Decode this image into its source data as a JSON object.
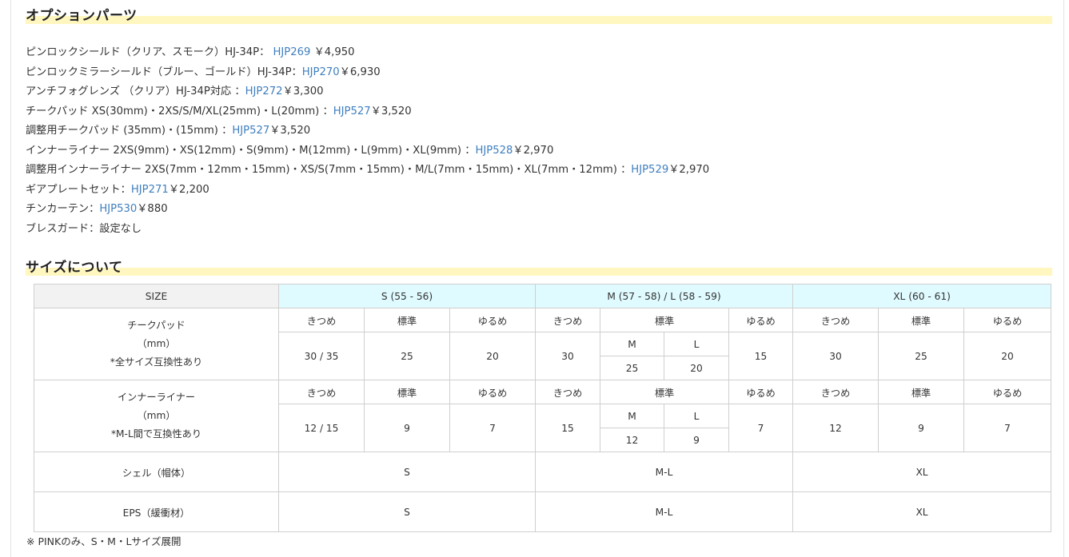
{
  "options_section": {
    "title": "オプションパーツ",
    "items": [
      {
        "text": "ピンロックシールド（クリア、スモーク）HJ-34P：",
        "code": "HJP269",
        "price": "￥4,950"
      },
      {
        "text": "ピンロックミラーシールド（ブルー、ゴールド）HJ-34P：",
        "code": "HJP270",
        "price": "￥6,930"
      },
      {
        "text": "アンチフォグレンズ （クリア）HJ-34P対応 ：",
        "code": "HJP272",
        "price": "￥3,300"
      },
      {
        "text": "チークパッド XS(30mm)・2XS/S/M/XL(25mm)・L(20mm) ：",
        "code": "HJP527",
        "price": "￥3,520"
      },
      {
        "text": "調整用チークパッド (35mm)・(15mm) ：",
        "code": "HJP527",
        "price": "￥3,520"
      },
      {
        "text": "インナーライナー 2XS(9mm)・XS(12mm)・S(9mm)・M(12mm)・L(9mm)・XL(9mm) ：",
        "code": "HJP528",
        "price": "￥2,970"
      },
      {
        "text": "調整用インナーライナー 2XS(7mm・12mm・15mm)・XS/S(7mm・15mm)・M/L(7mm・15mm)・XL(7mm・12mm) ：",
        "code": "HJP529",
        "price": "￥2,970"
      },
      {
        "text": "ギアプレートセット：",
        "code": "HJP271",
        "price": "￥2,200"
      },
      {
        "text": "チンカーテン：",
        "code": "HJP530",
        "price": "￥880"
      },
      {
        "text": "ブレスガード：設定なし",
        "code": "",
        "price": ""
      }
    ]
  },
  "size_section": {
    "title": "サイズについて",
    "header": {
      "label": "SIZE",
      "s": "S (55 - 56)",
      "ml": "M (57 - 58) / L (58 - 59)",
      "xl": "XL (60 - 61)"
    },
    "fit": {
      "tight": "きつめ",
      "standard": "標準",
      "loose": "ゆるめ"
    },
    "ml_split": {
      "m": "M",
      "l": "L"
    },
    "cheek": {
      "label1": "チークパッド",
      "label2": "（mm）",
      "label3": "*全サイズ互換性あり",
      "s_tight": "30 / 35",
      "s_std": "25",
      "s_loose": "20",
      "ml_tight": "30",
      "m_std": "25",
      "l_std": "20",
      "ml_loose": "15",
      "xl_tight": "30",
      "xl_std": "25",
      "xl_loose": "20"
    },
    "inner": {
      "label1": "インナーライナー",
      "label2": "（mm）",
      "label3": "*M-L間で互換性あり",
      "s_tight": "12 / 15",
      "s_std": "9",
      "s_loose": "7",
      "ml_tight": "15",
      "m_std": "12",
      "l_std": "9",
      "ml_loose": "7",
      "xl_tight": "12",
      "xl_std": "9",
      "xl_loose": "7"
    },
    "shell": {
      "label": "シェル（帽体）",
      "s": "S",
      "ml": "M-L",
      "xl": "XL"
    },
    "eps": {
      "label": "EPS（緩衝材）",
      "s": "S",
      "ml": "M-L",
      "xl": "XL"
    },
    "note": "※ PINKのみ、S・M・Lサイズ展開"
  },
  "colors": {
    "link": "#3f7fbf",
    "heading_highlight": "#fff7bf",
    "size_header_bg": "#e0fbff"
  }
}
